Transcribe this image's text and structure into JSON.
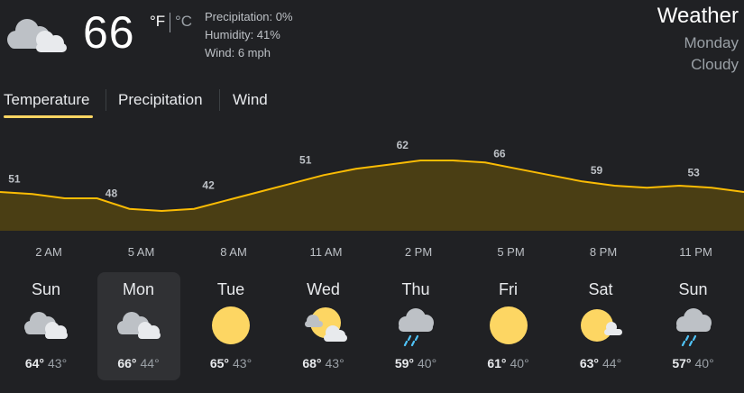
{
  "current": {
    "temp": "66",
    "unit_f": "°F",
    "unit_c": "°C",
    "precipitation": "Precipitation: 0%",
    "humidity": "Humidity: 41%",
    "wind": "Wind: 6 mph",
    "icon": "cloudy-icon"
  },
  "header": {
    "title": "Weather",
    "day": "Monday",
    "condition": "Cloudy"
  },
  "tabs": [
    {
      "label": "Temperature",
      "active": true
    },
    {
      "label": "Precipitation",
      "active": false
    },
    {
      "label": "Wind",
      "active": false
    }
  ],
  "chart_data": {
    "type": "area",
    "labels": [
      "51",
      "48",
      "42",
      "51",
      "62",
      "66",
      "59",
      "53"
    ],
    "x": [
      "2 AM",
      "5 AM",
      "8 AM",
      "11 AM",
      "2 PM",
      "5 PM",
      "8 PM",
      "11 PM"
    ],
    "values": [
      51,
      50,
      48,
      48,
      43,
      42,
      43,
      47,
      51,
      55,
      59,
      62,
      64,
      66,
      66,
      65,
      62,
      59,
      56,
      54,
      53,
      54,
      53,
      51
    ],
    "series_color": "#fbbc04",
    "fill_color": "#4a3e14"
  },
  "days": [
    {
      "name": "Sun",
      "hi": "64°",
      "lo": "43°",
      "icon": "cloudy-icon",
      "selected": false
    },
    {
      "name": "Mon",
      "hi": "66°",
      "lo": "44°",
      "icon": "cloudy-icon",
      "selected": true
    },
    {
      "name": "Tue",
      "hi": "65°",
      "lo": "43°",
      "icon": "sunny-icon",
      "selected": false
    },
    {
      "name": "Wed",
      "hi": "68°",
      "lo": "43°",
      "icon": "partly-cloudy-icon",
      "selected": false
    },
    {
      "name": "Thu",
      "hi": "59°",
      "lo": "40°",
      "icon": "rain-icon",
      "selected": false
    },
    {
      "name": "Fri",
      "hi": "61°",
      "lo": "40°",
      "icon": "sunny-icon",
      "selected": false
    },
    {
      "name": "Sat",
      "hi": "63°",
      "lo": "44°",
      "icon": "mostly-sunny-icon",
      "selected": false
    },
    {
      "name": "Sun",
      "hi": "57°",
      "lo": "40°",
      "icon": "rain-icon",
      "selected": false
    }
  ]
}
